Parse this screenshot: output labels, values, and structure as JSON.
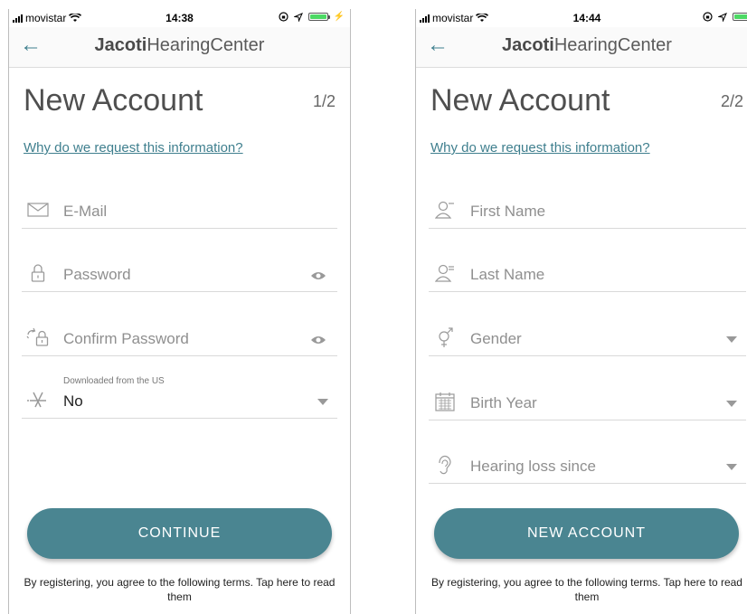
{
  "screens": [
    {
      "status": {
        "carrier": "movistar",
        "time": "14:38"
      },
      "header": {
        "brand_bold": "Jacoti",
        "brand_rest": "HearingCenter"
      },
      "title": "New Account",
      "step": "1/2",
      "why_link": "Why do we request this information?",
      "fields": {
        "email": {
          "placeholder": "E-Mail",
          "icon": "envelope-icon"
        },
        "password": {
          "placeholder": "Password",
          "icon": "lock-icon"
        },
        "confirm_password": {
          "placeholder": "Confirm Password",
          "icon": "refresh-lock-icon"
        },
        "downloaded": {
          "label": "Downloaded from the US",
          "value": "No",
          "icon": "app-store-icon"
        }
      },
      "button": "CONTINUE",
      "terms": "By registering, you agree to the following terms. Tap here to read them"
    },
    {
      "status": {
        "carrier": "movistar",
        "time": "14:44"
      },
      "header": {
        "brand_bold": "Jacoti",
        "brand_rest": "HearingCenter"
      },
      "title": "New Account",
      "step": "2/2",
      "why_link": "Why do we request this information?",
      "fields": {
        "first_name": {
          "placeholder": "First Name",
          "icon": "person-icon"
        },
        "last_name": {
          "placeholder": "Last Name",
          "icon": "person-lines-icon"
        },
        "gender": {
          "placeholder": "Gender",
          "icon": "gender-icon"
        },
        "birth_year": {
          "placeholder": "Birth Year",
          "icon": "calendar-icon"
        },
        "hearing_loss_since": {
          "placeholder": "Hearing loss since",
          "icon": "ear-icon"
        }
      },
      "button": "NEW ACCOUNT",
      "terms": "By registering, you agree to the following terms. Tap here to read them"
    }
  ],
  "colors": {
    "accent": "#4a8591",
    "link": "#3f7f8e",
    "battery": "#4cd964"
  }
}
